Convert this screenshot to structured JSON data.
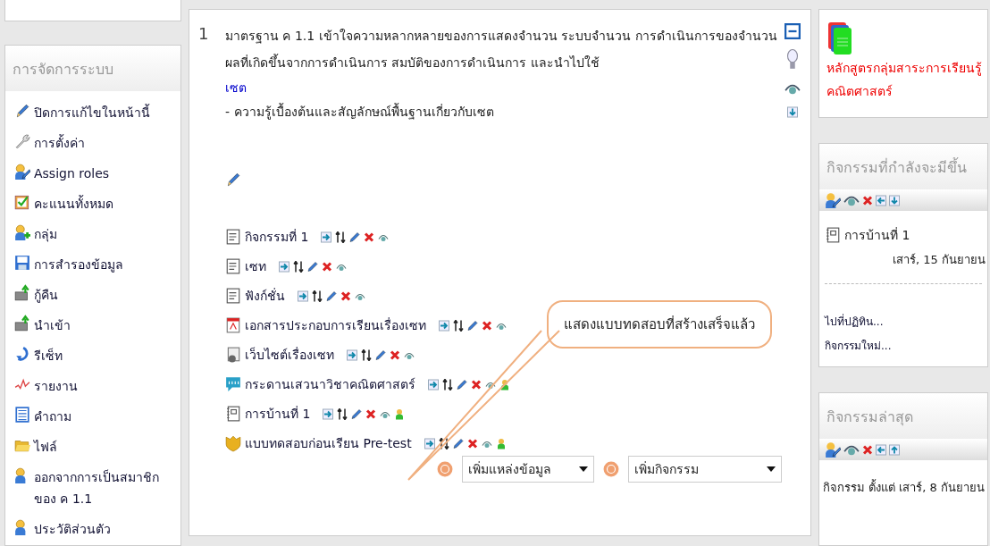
{
  "admin_block": {
    "title": "การจัดการระบบ",
    "items": [
      {
        "label": "ปิดการแก้ไขในหน้านี้"
      },
      {
        "label": "การตั้งค่า"
      },
      {
        "label": "Assign roles"
      },
      {
        "label": "คะแนนทั้งหมด"
      },
      {
        "label": "กลุ่ม"
      },
      {
        "label": "การสำรองข้อมูล"
      },
      {
        "label": "กู้คืน"
      },
      {
        "label": "นำเข้า"
      },
      {
        "label": "รีเซ็ท"
      },
      {
        "label": "รายงาน"
      },
      {
        "label": "คำถาม"
      },
      {
        "label": "ไฟล์"
      },
      {
        "label": "ออกจากการเป็นสมาชิกของ ค 1.1"
      },
      {
        "label": "ประวัติส่วนตัว"
      }
    ]
  },
  "section": {
    "number": "1",
    "summary": "มาตรฐาน ค 1.1 เข้าใจความหลากหลายของการแสดงจำนวน ระบบจำนวน การดำเนินการของจำนวน ผลที่เกิดขึ้นจากการดำเนินการ สมบัติของการดำเนินการ และนำไปใช้",
    "topic": "เซต",
    "topic_detail": "- ความรู้เบื้องต้นและสัญลักษณ์พื้นฐานเกี่ยวกับเซต",
    "activities": [
      {
        "kind": "page",
        "name": "กิจกรรมที่ 1",
        "group_mode": false
      },
      {
        "kind": "page",
        "name": "เซท",
        "group_mode": false
      },
      {
        "kind": "page",
        "name": "ฟังก์ชั่น",
        "group_mode": false
      },
      {
        "kind": "pdf",
        "name": "เอกสารประกอบการเรียนเรื่องเซท",
        "group_mode": false
      },
      {
        "kind": "web",
        "name": "เว็บไซต์เรื่องเซท",
        "group_mode": false
      },
      {
        "kind": "forum",
        "name": "กระดานเสวนาวิชาคณิตศาสตร์",
        "group_mode": true
      },
      {
        "kind": "assignment",
        "name": "การบ้านที่ 1",
        "group_mode": true
      },
      {
        "kind": "quiz",
        "name": "แบบทดสอบก่อนเรียน Pre-test",
        "group_mode": true
      }
    ],
    "add_resource": "เพิ่มแหล่งข้อมูล",
    "add_activity": "เพิ่มกิจกรรม",
    "callout": "แสดงแบบทดสอบที่สร้างเสร็จแล้ว"
  },
  "curriculum_block": {
    "link": "หลักสูตรกลุ่มสาระการเรียนรู้คณิตศาสตร์"
  },
  "upcoming_block": {
    "title": "กิจกรรมที่กำลังจะมีขึ้น",
    "event": "การบ้านที่ 1",
    "date": "เสาร์, 15 กันยายน",
    "links": [
      "ไปที่ปฏิทิน...",
      "กิจกรรมใหม่..."
    ]
  },
  "recent_block": {
    "title": "กิจกรรมล่าสุด",
    "text": "กิจกรรม ตั้งแต่ เสาร์, 8 กันยายน"
  }
}
